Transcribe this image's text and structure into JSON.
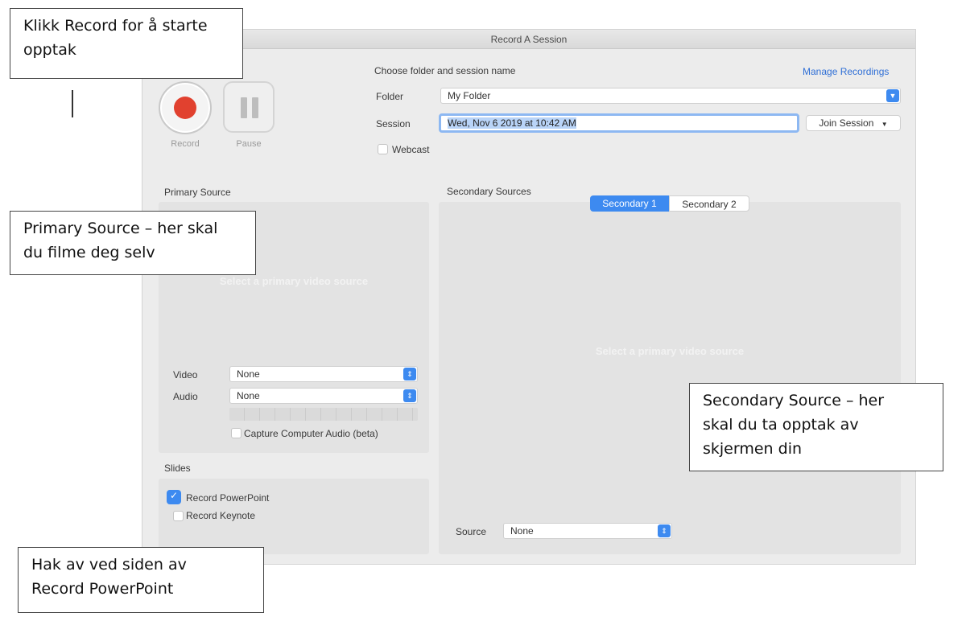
{
  "window": {
    "title": "Record A Session"
  },
  "controls": {
    "record_label": "Record",
    "pause_label": "Pause"
  },
  "session": {
    "heading": "Choose folder and session name",
    "manage_link": "Manage Recordings",
    "folder_label": "Folder",
    "folder_value": "My Folder",
    "session_label": "Session",
    "session_value": "Wed, Nov 6 2019 at 10:42 AM",
    "join_button": "Join Session",
    "webcast_label": "Webcast"
  },
  "primary": {
    "heading": "Primary Source",
    "placeholder": "Select a primary video source",
    "video_label": "Video",
    "video_value": "None",
    "audio_label": "Audio",
    "audio_value": "None",
    "capture_audio_label": "Capture Computer Audio (beta)"
  },
  "slides": {
    "heading": "Slides",
    "record_powerpoint": "Record PowerPoint",
    "record_powerpoint_checked": true,
    "record_keynote": "Record Keynote",
    "record_keynote_checked": false
  },
  "secondary": {
    "heading": "Secondary Sources",
    "tabs": [
      "Secondary 1",
      "Secondary 2"
    ],
    "active_tab": "Secondary 1",
    "placeholder": "Select a primary video source",
    "source_label": "Source",
    "source_value": "None"
  },
  "callouts": {
    "record": [
      "Klikk Record for å starte",
      "opptak"
    ],
    "primary": [
      "Primary Source – her skal",
      "du filme deg selv"
    ],
    "secondary": [
      "Secondary Source – her",
      "skal du ta opptak av",
      "skjermen din"
    ],
    "slides": [
      "Hak av ved siden av",
      "Record PowerPoint"
    ]
  },
  "colors": {
    "accent": "#3d8af0",
    "record": "#e1412f",
    "window_bg": "#ececec"
  }
}
